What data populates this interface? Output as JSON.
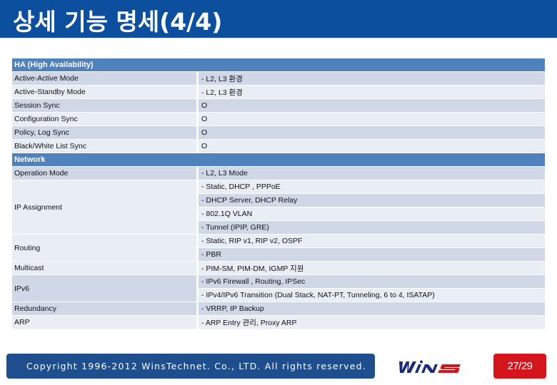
{
  "title": "상세 기능 명세(4/4)",
  "sections": [
    {
      "header": "HA (High Availability)",
      "rows": [
        {
          "key": "Active-Active Mode",
          "values": [
            "- L2, L3 환경"
          ]
        },
        {
          "key": "Active-Standby Mode",
          "values": [
            "- L2, L3 환경"
          ]
        },
        {
          "key": "Session Sync",
          "values": [
            "O"
          ]
        },
        {
          "key": "Configuration Sync",
          "values": [
            "O"
          ]
        },
        {
          "key": "Policy, Log Sync",
          "values": [
            "O"
          ]
        },
        {
          "key": "Black/White List Sync",
          "values": [
            "O"
          ]
        }
      ]
    },
    {
      "header": "Network",
      "rows": [
        {
          "key": "Operation Mode",
          "values": [
            "- L2, L3 Mode"
          ]
        },
        {
          "key": "IP Assignment",
          "values": [
            "- Static, DHCP , PPPoE",
            "- DHCP Server, DHCP Relay",
            "- 802.1Q VLAN",
            "- Tunnel (IPIP, GRE)"
          ]
        },
        {
          "key": "Routing",
          "values": [
            "- Static, RIP v1, RIP v2, OSPF",
            "- PBR"
          ]
        },
        {
          "key": "Multicast",
          "values": [
            "- PIM-SM, PIM-DM, IGMP 지원"
          ]
        },
        {
          "key": "IPv6",
          "values": [
            "- IPv6 Firewall , Routing, IPSec",
            "- IPv4/IPv6 Transition (Dual Stack, NAT-PT, Tunneling, 6 to 4, ISATAP)"
          ]
        },
        {
          "key": "Redundancy",
          "values": [
            "- VRRP, IP Backup"
          ]
        },
        {
          "key": "ARP",
          "values": [
            "- ARP Entry 관리, Proxy ARP"
          ]
        }
      ]
    }
  ],
  "footer": {
    "copyright": "Copyright 1996-2012 WinsTechnet. Co., LTD. All rights reserved.",
    "logo_text": "WINS",
    "page": "27/29"
  },
  "colors": {
    "title_bar": "#0b4f9e",
    "section_header": "#4f81bd",
    "row_dark": "#d0d8e8",
    "row_light": "#e9edf4",
    "footer_bar": "#1f4e8f",
    "logo_blue": "#1a2a7c",
    "logo_red": "#d4161c",
    "page_badge": "#d4161c"
  }
}
